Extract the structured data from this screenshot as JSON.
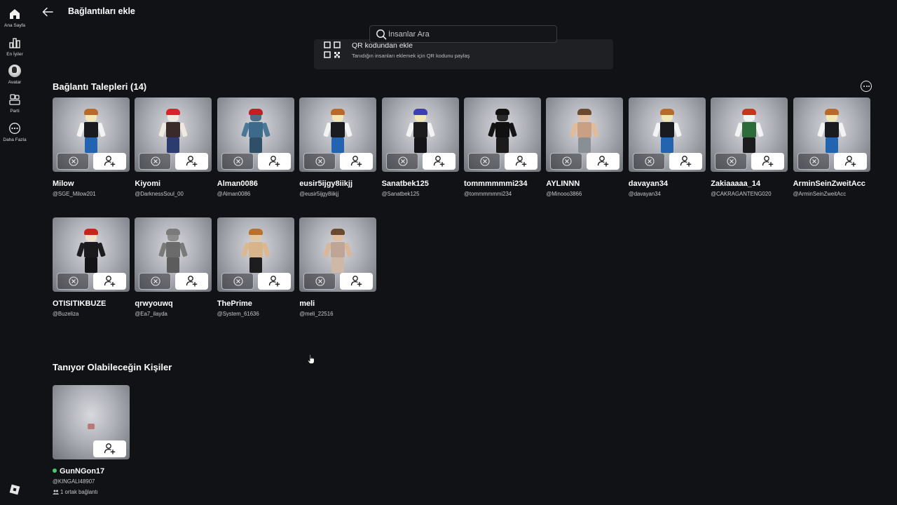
{
  "nav": {
    "items": [
      {
        "label": "Ana Sayfa",
        "icon": "home-icon"
      },
      {
        "label": "En İyiler",
        "icon": "charts-icon"
      },
      {
        "label": "Avatar",
        "icon": "avatar-icon"
      },
      {
        "label": "Parti",
        "icon": "party-icon"
      },
      {
        "label": "Daha Fazla",
        "icon": "more-icon"
      }
    ]
  },
  "header": {
    "title": "Bağlantıları ekle",
    "search_placeholder": "İnsanlar Ara"
  },
  "qr_card": {
    "title": "QR kodundan ekle",
    "subtitle": "Tanıdığın insanları eklemek için QR kodunu paylaş"
  },
  "requests": {
    "title": "Bağlantı Talepleri (14)",
    "items": [
      {
        "name": "Milow",
        "handle": "@SGE_Milow201",
        "hair": "#b86a2a",
        "head": "#f1e7b2",
        "torso": "#1a1b1e",
        "arms": "#f3f3f3",
        "legs": "#2264b0"
      },
      {
        "name": "Kiyomi",
        "handle": "@DarknessSoul_00",
        "hair": "#d9222a",
        "head": "#efe9e0",
        "torso": "#3a2a2a",
        "arms": "#efe9e0",
        "legs": "#2c3c6e"
      },
      {
        "name": "Alman0086",
        "handle": "@Alman0086",
        "hair": "#c21e23",
        "head": "#4b6e85",
        "torso": "#3c6a8a",
        "arms": "#4a7796",
        "legs": "#2f4f66"
      },
      {
        "name": "eusir5ijgy8iikjj",
        "handle": "@eusir5ijgy8iikjj",
        "hair": "#b86a2a",
        "head": "#f1e7b2",
        "torso": "#1a1b1e",
        "arms": "#f3f3f3",
        "legs": "#2264b0"
      },
      {
        "name": "Sanatbek125",
        "handle": "@Sanatbek125",
        "hair": "#3b3fb0",
        "head": "#f1e7b2",
        "torso": "#1c1c1f",
        "arms": "#f3f3f3",
        "legs": "#151517"
      },
      {
        "name": "tommmmmmi234",
        "handle": "@tommmmmmi234",
        "hair": "#111111",
        "head": "#2a2a2a",
        "torso": "#111111",
        "arms": "#141414",
        "legs": "#1b1b1b"
      },
      {
        "name": "AYLINNN",
        "handle": "@Minooo3866",
        "hair": "#6b4a2e",
        "head": "#e7c3a2",
        "torso": "#caa084",
        "arms": "#e2bb99",
        "legs": "#8a8f96"
      },
      {
        "name": "davayan34",
        "handle": "@davayan34",
        "hair": "#b86a2a",
        "head": "#f1e7b2",
        "torso": "#1a1b1e",
        "arms": "#f3f3f3",
        "legs": "#2264b0"
      },
      {
        "name": "Zakiaaaaa_14",
        "handle": "@CAKRAGANTENG020",
        "hair": "#c8341c",
        "head": "#f3f3f3",
        "torso": "#2e6b3a",
        "arms": "#f3f3f3",
        "legs": "#1c1c1f"
      },
      {
        "name": "ArminSeinZweitAcc",
        "handle": "@ArminSeinZweitAcc",
        "hair": "#b86a2a",
        "head": "#f1e7b2",
        "torso": "#1a1b1e",
        "arms": "#f3f3f3",
        "legs": "#2264b0"
      },
      {
        "name": "OTISITIKBUZE",
        "handle": "@Buzeliza",
        "hair": "#c8241c",
        "head": "#f0e1c8",
        "torso": "#1a1a1c",
        "arms": "#1d1d20",
        "legs": "#141416"
      },
      {
        "name": "qrwyouwq",
        "handle": "@Ea7_ilayda",
        "hair": "#7a7a7a",
        "head": "#8c8c8c",
        "torso": "#6b6b6b",
        "arms": "#7a7a7a",
        "legs": "#5c5c5c"
      },
      {
        "name": "ThePrime",
        "handle": "@System_61636",
        "hair": "#b8702a",
        "head": "#e2c8a0",
        "torso": "#d7b48a",
        "arms": "#dcb890",
        "legs": "#1d1d20"
      },
      {
        "name": "meli",
        "handle": "@meli_22516",
        "hair": "#6a4a30",
        "head": "#e0c0a0",
        "torso": "#bfa595",
        "arms": "#d9b89a",
        "legs": "#d0b8a8"
      }
    ]
  },
  "suggestions": {
    "title": "Tanıyor Olabileceğin Kişiler",
    "items": [
      {
        "name": "GunNGon17",
        "handle": "@KINGALI48907",
        "mutual": "1 ortak bağlantı",
        "online": true
      }
    ]
  },
  "colors": {
    "background": "#111216",
    "card": "#1f2024",
    "online": "#3ecf6a"
  }
}
